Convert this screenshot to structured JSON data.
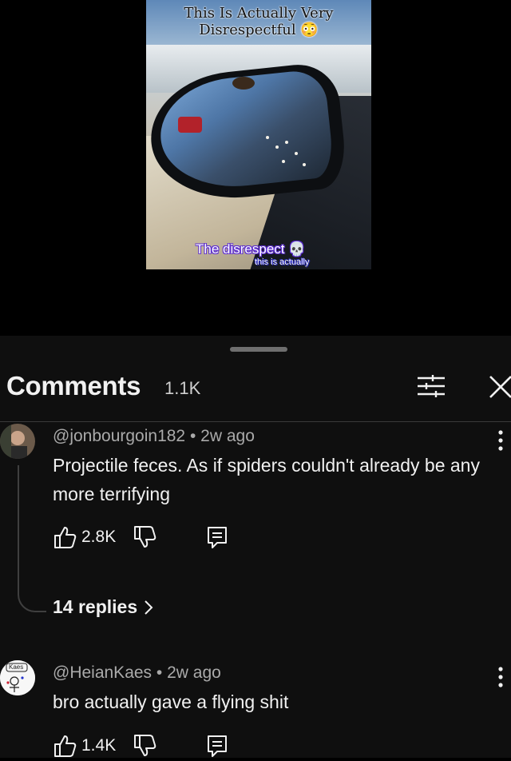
{
  "video": {
    "caption_top": "This Is Actually Very Disrespectful 😳",
    "caption_bottom": "The disrespect 💀",
    "caption_small": "this is actually"
  },
  "comments_header": {
    "title": "Comments",
    "count": "1.1K"
  },
  "comments": [
    {
      "author": "@jonbourgoin182",
      "age": "2w ago",
      "text": "Projectile feces. As if spiders couldn't already be any more terrifying",
      "likes": "2.8K",
      "replies_label": "14 replies"
    },
    {
      "author": "@HeianKaes",
      "age": "2w ago",
      "text": "bro actually gave a flying shit",
      "likes": "1.4K",
      "avatar_text": "Kaes"
    }
  ],
  "separator": "•"
}
